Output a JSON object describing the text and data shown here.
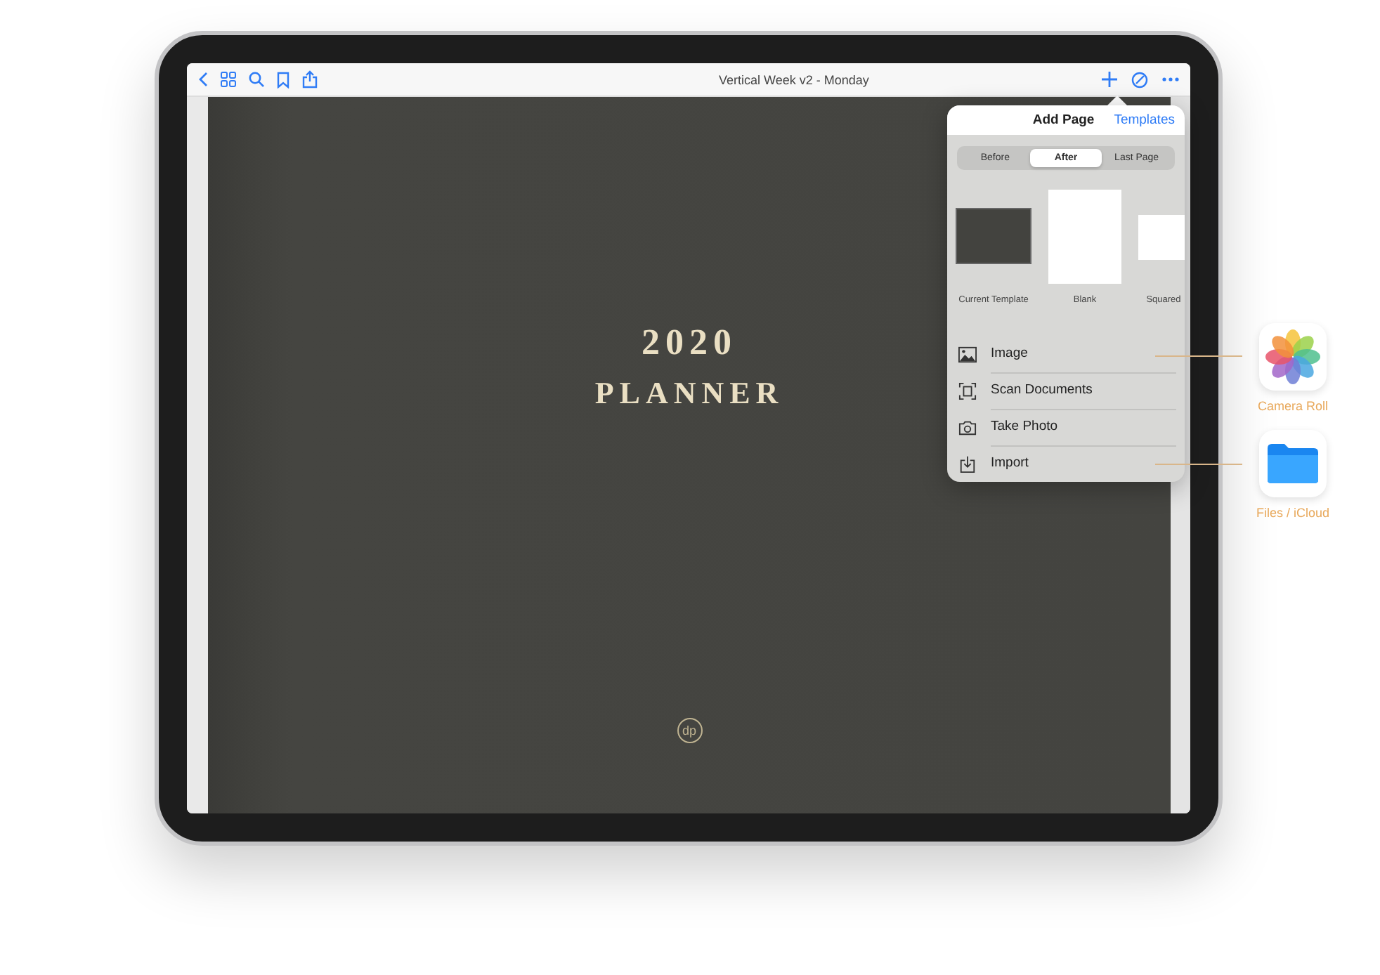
{
  "toolbar": {
    "title": "Vertical Week v2 - Monday"
  },
  "cover": {
    "year": "2020",
    "title": "PLANNER",
    "logo": "dp"
  },
  "popover": {
    "title": "Add Page",
    "action": "Templates",
    "segments": [
      {
        "label": "Before",
        "selected": false
      },
      {
        "label": "After",
        "selected": true
      },
      {
        "label": "Last Page",
        "selected": false
      }
    ],
    "templates": [
      {
        "label": "Current Template",
        "kind": "cover"
      },
      {
        "label": "Blank",
        "kind": "blank"
      },
      {
        "label": "Squared",
        "kind": "squared"
      }
    ],
    "items": [
      {
        "label": "Image",
        "kind": "image"
      },
      {
        "label": "Scan Documents",
        "kind": "scan"
      },
      {
        "label": "Take Photo",
        "kind": "camera"
      },
      {
        "label": "Import",
        "kind": "import"
      }
    ]
  },
  "callouts": [
    {
      "label": "Camera Roll",
      "kind": "photos"
    },
    {
      "label": "Files / iCloud",
      "kind": "files"
    }
  ]
}
